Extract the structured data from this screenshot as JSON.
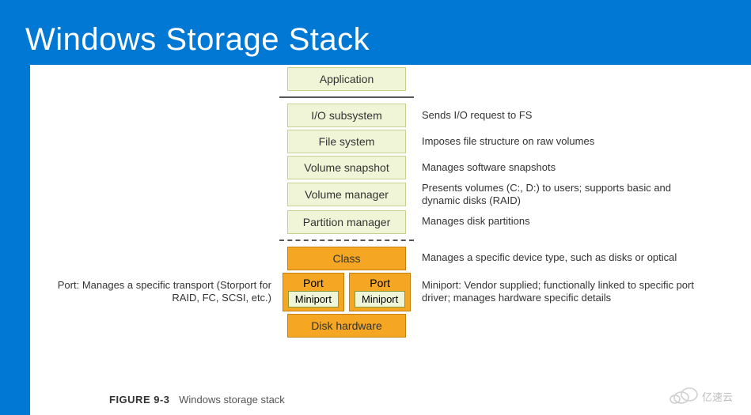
{
  "title": "Windows Storage Stack",
  "layers": {
    "application": {
      "label": "Application",
      "desc": ""
    },
    "io_subsystem": {
      "label": "I/O subsystem",
      "desc": "Sends I/O request to FS"
    },
    "file_system": {
      "label": "File system",
      "desc": "Imposes file structure on raw volumes"
    },
    "volume_snapshot": {
      "label": "Volume snapshot",
      "desc": "Manages software snapshots"
    },
    "volume_manager": {
      "label": "Volume manager",
      "desc": "Presents volumes (C:, D:) to users; supports basic and dynamic disks (RAID)"
    },
    "partition_manager": {
      "label": "Partition manager",
      "desc": "Manages disk partitions"
    },
    "class": {
      "label": "Class",
      "desc": "Manages a specific device type, such as disks or optical"
    },
    "port_left_desc": "Port: Manages a specific transport (Storport for RAID, FC, SCSI, etc.)",
    "port1": {
      "label": "Port",
      "mini": "Miniport"
    },
    "port2": {
      "label": "Port",
      "mini": "Miniport"
    },
    "miniport_right_desc": "Miniport: Vendor supplied; functionally linked to specific port driver; manages hardware specific details",
    "disk_hardware": {
      "label": "Disk hardware",
      "desc": ""
    }
  },
  "caption_fig": "FIGURE 9-3",
  "caption_text": "Windows storage stack",
  "watermark": "亿速云"
}
